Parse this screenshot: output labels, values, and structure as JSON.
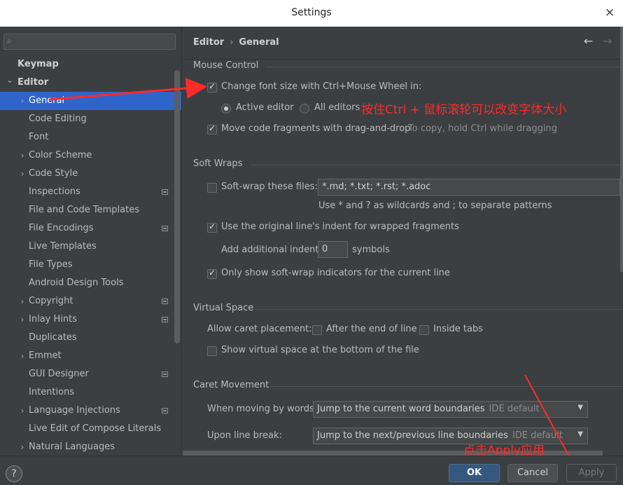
{
  "window": {
    "title": "Settings",
    "close_icon": "×"
  },
  "search": {
    "placeholder": "",
    "icon": "search-icon"
  },
  "tree": [
    {
      "label": "Keymap",
      "bold": true,
      "level": 0,
      "arrow": "",
      "project": false
    },
    {
      "label": "Editor",
      "bold": true,
      "level": 0,
      "arrow": "v",
      "project": false
    },
    {
      "label": "General",
      "level": 1,
      "arrow": ">",
      "selected": true,
      "project": false
    },
    {
      "label": "Code Editing",
      "level": 1,
      "arrow": "",
      "project": false
    },
    {
      "label": "Font",
      "level": 1,
      "arrow": "",
      "project": false
    },
    {
      "label": "Color Scheme",
      "level": 1,
      "arrow": ">",
      "project": false
    },
    {
      "label": "Code Style",
      "level": 1,
      "arrow": ">",
      "project": false
    },
    {
      "label": "Inspections",
      "level": 1,
      "arrow": "",
      "project": true
    },
    {
      "label": "File and Code Templates",
      "level": 1,
      "arrow": "",
      "project": false
    },
    {
      "label": "File Encodings",
      "level": 1,
      "arrow": "",
      "project": true
    },
    {
      "label": "Live Templates",
      "level": 1,
      "arrow": "",
      "project": false
    },
    {
      "label": "File Types",
      "level": 1,
      "arrow": "",
      "project": false
    },
    {
      "label": "Android Design Tools",
      "level": 1,
      "arrow": "",
      "project": false
    },
    {
      "label": "Copyright",
      "level": 1,
      "arrow": ">",
      "project": true
    },
    {
      "label": "Inlay Hints",
      "level": 1,
      "arrow": ">",
      "project": true
    },
    {
      "label": "Duplicates",
      "level": 1,
      "arrow": "",
      "project": false
    },
    {
      "label": "Emmet",
      "level": 1,
      "arrow": ">",
      "project": false
    },
    {
      "label": "GUI Designer",
      "level": 1,
      "arrow": "",
      "project": true
    },
    {
      "label": "Intentions",
      "level": 1,
      "arrow": "",
      "project": false
    },
    {
      "label": "Language Injections",
      "level": 1,
      "arrow": ">",
      "project": true
    },
    {
      "label": "Live Edit of Compose Literals",
      "level": 1,
      "arrow": "",
      "project": false
    },
    {
      "label": "Natural Languages",
      "level": 1,
      "arrow": ">",
      "project": false
    }
  ],
  "breadcrumb": {
    "part1": "Editor",
    "sep": "›",
    "part2": "General"
  },
  "nav": {
    "back": "←",
    "forward": "→"
  },
  "mouse_control": {
    "title": "Mouse Control",
    "change_font_size": {
      "label": "Change font size with Ctrl+Mouse Wheel in:",
      "checked": true
    },
    "active_editor": {
      "label": "Active editor",
      "selected": true
    },
    "all_editors": {
      "label": "All editors",
      "selected": false
    },
    "move_fragments": {
      "label": "Move code fragments with drag-and-drop",
      "checked": true
    },
    "move_hint": "To copy, hold Ctrl while dragging"
  },
  "soft_wraps": {
    "title": "Soft Wraps",
    "soft_wrap_files": {
      "label": "Soft-wrap these files:",
      "checked": false,
      "value": "*.md; *.txt; *.rst; *.adoc"
    },
    "wildcard_hint": "Use * and ? as wildcards and ; to separate patterns",
    "original_indent": {
      "label": "Use the original line's indent for wrapped fragments",
      "checked": true
    },
    "additional_indent": {
      "label": "Add additional indent:",
      "value": "0",
      "suffix": "symbols"
    },
    "only_current": {
      "label": "Only show soft-wrap indicators for the current line",
      "checked": true
    }
  },
  "virtual_space": {
    "title": "Virtual Space",
    "allow_caret": "Allow caret placement:",
    "after_end": {
      "label": "After the end of line",
      "checked": false
    },
    "inside_tabs": {
      "label": "Inside tabs",
      "checked": false
    },
    "show_bottom": {
      "label": "Show virtual space at the bottom of the file",
      "checked": false
    }
  },
  "caret_movement": {
    "title": "Caret Movement",
    "by_words": {
      "label": "When moving by words:",
      "value": "Jump to the current word boundaries",
      "tag": "IDE default"
    },
    "line_break": {
      "label": "Upon line break:",
      "value": "Jump to the next/previous line boundaries",
      "tag": "IDE default"
    }
  },
  "annotations": {
    "ctrl_note": "按住Ctrl + 鼠标滚轮可以改变字体大小",
    "apply_note": "点击Apply应用",
    "color": "#ff2a2a"
  },
  "footer": {
    "help": "?",
    "ok": "OK",
    "cancel": "Cancel",
    "apply": "Apply"
  }
}
